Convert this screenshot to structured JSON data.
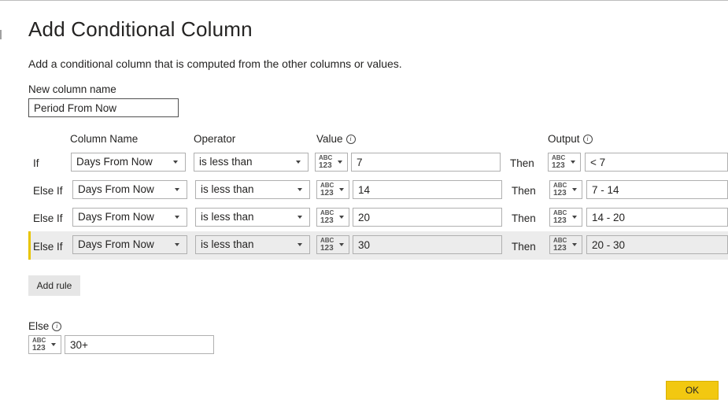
{
  "dialog": {
    "title": "Add Conditional Column",
    "description": "Add a conditional column that is computed from the other columns or values."
  },
  "new_column": {
    "label": "New column name",
    "value": "Period From Now"
  },
  "headers": {
    "column_name": "Column Name",
    "operator": "Operator",
    "value": "Value",
    "output": "Output"
  },
  "type_icon": {
    "abc": "ABC",
    "num": "123"
  },
  "rules": [
    {
      "prefix": "If",
      "column": "Days From Now",
      "operator": "is less than",
      "value": "7",
      "then": "Then",
      "output": "< 7"
    },
    {
      "prefix": "Else If",
      "column": "Days From Now",
      "operator": "is less than",
      "value": "14",
      "then": "Then",
      "output": "7 - 14"
    },
    {
      "prefix": "Else If",
      "column": "Days From Now",
      "operator": "is less than",
      "value": "20",
      "then": "Then",
      "output": "14 - 20"
    },
    {
      "prefix": "Else If",
      "column": "Days From Now",
      "operator": "is less than",
      "value": "30",
      "then": "Then",
      "output": "20 - 30"
    }
  ],
  "add_rule_label": "Add rule",
  "else": {
    "label": "Else",
    "value": "30+"
  },
  "ok_label": "OK",
  "colors": {
    "accent": "#f2c811",
    "selected_row_bar": "#e8c500",
    "selected_row_bg": "#ececec"
  }
}
